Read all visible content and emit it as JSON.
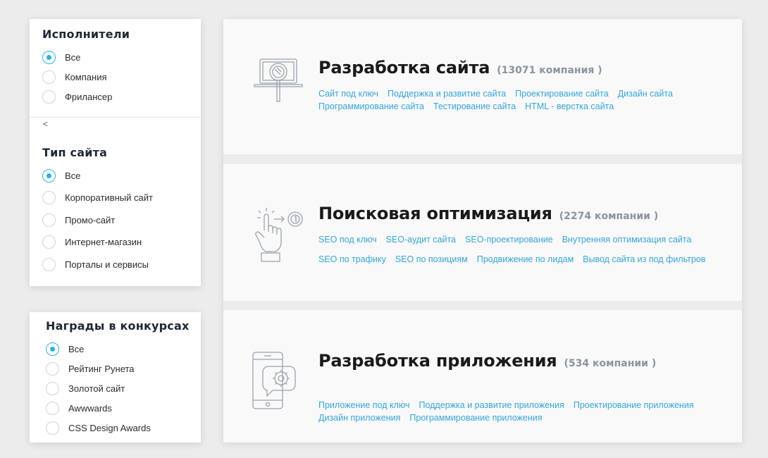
{
  "filters": {
    "performers": {
      "title": "Исполнители",
      "options": [
        "Все",
        "Компания",
        "Фрилансер"
      ],
      "selected": 0
    },
    "back_label": "<",
    "site_type": {
      "title": "Тип сайта",
      "options": [
        "Все",
        "Корпоративный сайт",
        "Промо-сайт",
        "Интернет-магазин",
        "Порталы и сервисы"
      ],
      "selected": 0
    },
    "awards": {
      "title": "Награды в конкурсах",
      "options": [
        "Все",
        "Рейтинг Рунета",
        "Золотой сайт",
        "Awwwards",
        "CSS Design Awards"
      ],
      "selected": 0
    }
  },
  "categories": [
    {
      "title": "Разработка сайта",
      "count": "(13071 компания )",
      "icon": "laptop-magnifier-icon",
      "links": [
        [
          "Сайт под ключ",
          "Поддержка и развитие сайта",
          "Проектирование сайта",
          "Дизайн сайта"
        ],
        [
          "Программирование сайта",
          "Тестирование сайта",
          "HTML - верстка сайта"
        ]
      ]
    },
    {
      "title": "Поисковая оптимизация",
      "count": "(2274 компании )",
      "icon": "hand-click-icon",
      "links": [
        [
          "SEO под ключ",
          "SEO-аудит сайта",
          "SEO-проектирование",
          "Внутренняя оптимизация сайта"
        ],
        [
          "SEO по трафику",
          "SEO по позициям",
          "Продвижение по лидам",
          "Вывод сайта из под фильтров"
        ]
      ]
    },
    {
      "title": "Разработка приложения",
      "count": "(534 компании )",
      "icon": "phone-gear-icon",
      "links": [
        [
          "Приложение под ключ",
          "Поддержка и развитие приложения",
          "Проектирование приложения"
        ],
        [
          "Дизайн приложения",
          "Программирование приложения"
        ]
      ]
    }
  ],
  "colors": {
    "accent": "#2ab0e4",
    "link": "#37a5d8",
    "count": "#8a94a2"
  }
}
